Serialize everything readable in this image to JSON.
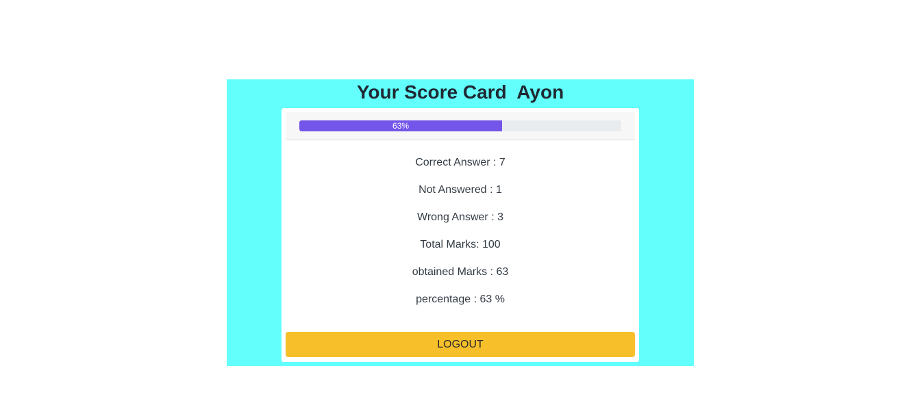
{
  "scorecard": {
    "title": "Your Score Card  Ayon",
    "progress": {
      "percent": 63,
      "label": "63%",
      "color": "#7356e9"
    },
    "stats": [
      "Correct Answer : 7",
      "Not Answered : 1",
      "Wrong Answer : 3",
      "Total Marks: 100",
      "obtained Marks : 63",
      "percentage : 63 %"
    ],
    "logout_label": "LOGOUT"
  },
  "colors": {
    "panel_background": "#62fffc",
    "logout_button": "#f7c02a"
  }
}
